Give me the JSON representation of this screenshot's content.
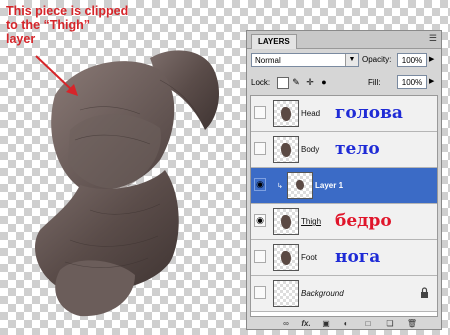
{
  "annotation": {
    "lines": [
      "This piece is clipped",
      "to the “Thigh”",
      "layer"
    ],
    "color": "#d6252a"
  },
  "panel": {
    "tab_label": "LAYERS",
    "menu_icon": "panel-menu-icon",
    "blend_mode": "Normal",
    "opacity_label": "Opacity:",
    "opacity_value": "100%",
    "lock_label": "Lock:",
    "fill_label": "Fill:",
    "fill_value": "100%",
    "selection_color": "#3b6bc6"
  },
  "layers": [
    {
      "name": "Head",
      "russian": "голова",
      "russian_color": "#1f2bd6",
      "visible": false,
      "selected": false,
      "clipped": false
    },
    {
      "name": "Body",
      "russian": "тело",
      "russian_color": "#1f2bd6",
      "visible": false,
      "selected": false,
      "clipped": false
    },
    {
      "name": "Layer 1",
      "russian": "",
      "russian_color": "",
      "visible": true,
      "selected": true,
      "clipped": true
    },
    {
      "name": "Thigh",
      "russian": "бедро",
      "russian_color": "#e0152a",
      "visible": true,
      "selected": false,
      "clipped": false
    },
    {
      "name": "Foot",
      "russian": "нога",
      "russian_color": "#1f2bd6",
      "visible": false,
      "selected": false,
      "clipped": false
    },
    {
      "name": "Background",
      "russian": "",
      "russian_color": "",
      "visible": false,
      "selected": false,
      "clipped": false,
      "locked": true
    }
  ],
  "bottom_icons": [
    "link-layers-icon",
    "fx-icon",
    "add-mask-icon",
    "adjustment-layer-icon",
    "new-group-icon",
    "new-layer-icon",
    "trash-icon"
  ],
  "fx_label": "fx."
}
